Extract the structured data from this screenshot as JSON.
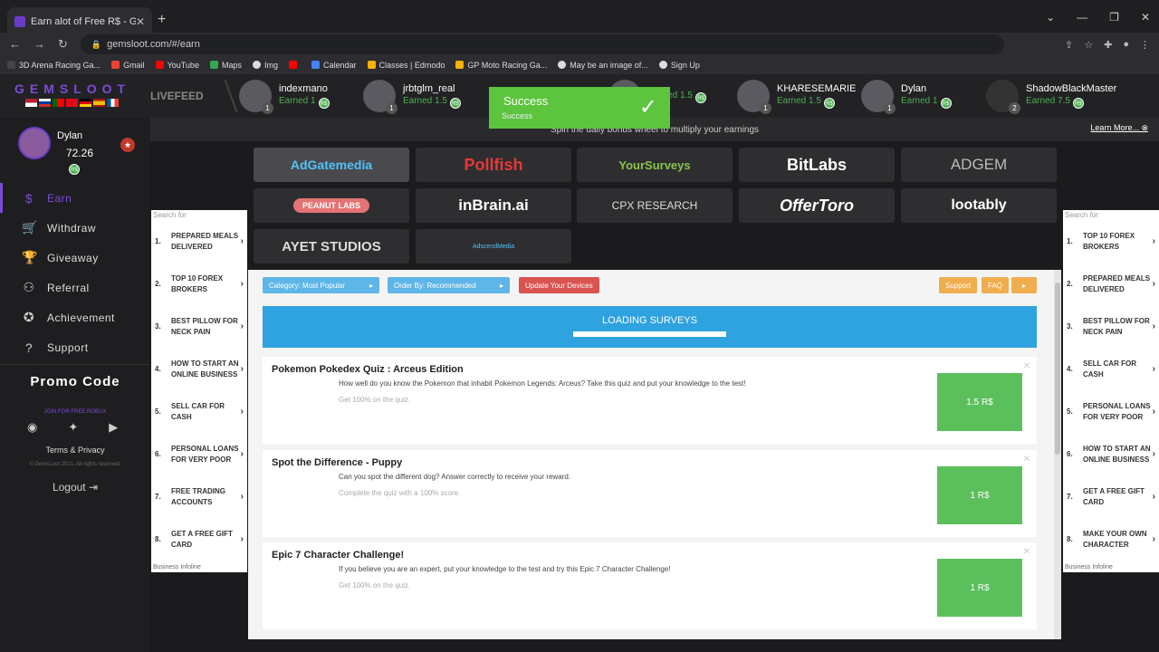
{
  "browser": {
    "tab_title": "Earn alot of Free R$ - GemsLoot",
    "url": "gemsloot.com/#/earn",
    "bookmarks": [
      "3D Arena Racing Ga...",
      "Gmail",
      "YouTube",
      "Maps",
      "Img",
      "Calendar",
      "Classes | Edmodo",
      "GP Moto Racing Ga...",
      "May be an image of...",
      "Sign Up"
    ]
  },
  "header": {
    "logo": "GEMSLOOT",
    "livefeed": "LIVEFEED",
    "feed": [
      {
        "name": "indexmano",
        "earned": "Earned 1",
        "level": "1"
      },
      {
        "name": "jrbtglm_real",
        "earned": "Earned 1.5",
        "level": "1"
      },
      {
        "name": "",
        "earned": "Earned 1.5",
        "level": "1"
      },
      {
        "name": "KHARESEMARIE",
        "earned": "Earned 1.5",
        "level": "1"
      },
      {
        "name": "Dylan",
        "earned": "Earned 1",
        "level": "1"
      },
      {
        "name": "ShadowBlackMaster",
        "earned": "Earned 7.5",
        "level": "2"
      }
    ],
    "learn_banner": "Spin the daily bonus wheel to multiply your earnings",
    "learn_more": "Learn More..."
  },
  "toast": {
    "title": "Success",
    "subtitle": "Success"
  },
  "user": {
    "name": "Dylan",
    "balance": "72.26"
  },
  "menu": [
    {
      "label": "Earn",
      "icon": "dollar-icon"
    },
    {
      "label": "Withdraw",
      "icon": "cart-icon"
    },
    {
      "label": "Giveaway",
      "icon": "trophy-icon"
    },
    {
      "label": "Referral",
      "icon": "referral-icon"
    },
    {
      "label": "Achievement",
      "icon": "achievement-icon"
    },
    {
      "label": "Support",
      "icon": "help-icon"
    }
  ],
  "promo": "Promo Code",
  "join": "JOIN FOR FREE ROBUX",
  "terms": "Terms & Privacy",
  "copyright": "© GemsLoot 2021. All rights reserved.",
  "logout": "Logout",
  "offerwalls": [
    {
      "label": "AdGatemedia",
      "color": "#4fc3f7"
    },
    {
      "label": "Pollfish",
      "color": "#e53935"
    },
    {
      "label": "YourSurveys",
      "color": "#8bc34a"
    },
    {
      "label": "BitLabs",
      "color": "#ffffff"
    },
    {
      "label": "ADGEM",
      "color": "#bbbbbb"
    },
    {
      "label": "PEANUT LABS",
      "color": "#e57373"
    },
    {
      "label": "inBrain.ai",
      "color": "#ffffff"
    },
    {
      "label": "CPX RESEARCH",
      "color": "#dddddd"
    },
    {
      "label": "OfferToro",
      "color": "#ffffff"
    },
    {
      "label": "lootably",
      "color": "#ffffff"
    },
    {
      "label": "AYET STUDIOS",
      "color": "#dddddd"
    },
    {
      "label": "AdscendMedia",
      "color": "#4fc3f7"
    }
  ],
  "ads_left": {
    "search": "Search for",
    "items": [
      "PREPARED MEALS DELIVERED",
      "TOP 10 FOREX BROKERS",
      "BEST PILLOW FOR NECK PAIN",
      "HOW TO START AN ONLINE BUSINESS",
      "SELL CAR FOR CASH",
      "PERSONAL LOANS FOR VERY POOR",
      "FREE TRADING ACCOUNTS",
      "GET A FREE GIFT CARD"
    ],
    "footer": "Business Infoline"
  },
  "ads_right": {
    "search": "Search for",
    "items": [
      "TOP 10 FOREX BROKERS",
      "PREPARED MEALS DELIVERED",
      "BEST PILLOW FOR NECK PAIN",
      "SELL CAR FOR CASH",
      "PERSONAL LOANS FOR VERY POOR",
      "HOW TO START AN ONLINE BUSINESS",
      "GET A FREE GIFT CARD",
      "MAKE YOUR OWN CHARACTER"
    ],
    "footer": "Business Infoline"
  },
  "filters": {
    "category": "Category: Most Popular",
    "order": "Order By: Recommended",
    "update": "Update Your Devices",
    "support": "Support",
    "faq": "FAQ"
  },
  "loading": "LOADING SURVEYS",
  "surveys": [
    {
      "title": "Pokemon Pokedex Quiz : Arceus Edition",
      "desc": "How well do you know the Pokemon that inhabit Pokemon Legends: Arceus? Take this quiz and put your knowledge to the test!",
      "sub": "Get 100% on the quiz.",
      "reward": "1.5 R$"
    },
    {
      "title": "Spot the Difference - Puppy",
      "desc": "Can you spot the different dog? Answer correctly to receive your reward.",
      "sub": "Complete the quiz with a 100% score.",
      "reward": "1 R$"
    },
    {
      "title": "Epic 7 Character Challenge!",
      "desc": "If you believe you are an expert, put your knowledge to the test and try this Epic 7 Character Challenge!",
      "sub": "Get 100% on the quiz.",
      "reward": "1 R$"
    }
  ],
  "colors": {
    "accent": "#7b4bd8",
    "success": "#5dc43d",
    "reward": "#5bc05b",
    "loading": "#2fa2e0"
  }
}
